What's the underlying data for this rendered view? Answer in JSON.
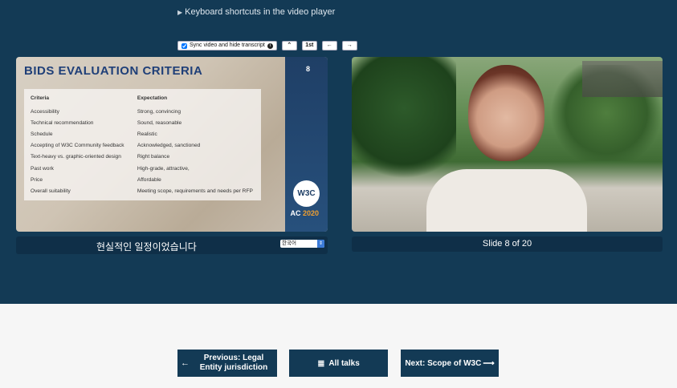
{
  "shortcuts": {
    "label": "Keyboard shortcuts in the video player"
  },
  "controls": {
    "sync_label": "Sync video and hide transcript",
    "up": "⌃",
    "first": "1st",
    "prev": "←",
    "next": "→"
  },
  "slide": {
    "title": "BIDS EVALUATION CRITERIA",
    "page": "8",
    "headers": [
      "Criteria",
      "Expectation"
    ],
    "rows": [
      [
        "Accessibility",
        "Strong, convincing"
      ],
      [
        "Technical recommendation",
        "Sound, reasonable"
      ],
      [
        "Schedule",
        "Realistic"
      ],
      [
        "Accepting of W3C Community feedback",
        "Acknowledged, sanctioned"
      ],
      [
        "Text-heavy vs. graphic-oriented design",
        "Right balance"
      ],
      [
        "Past work",
        "High-grade, attractive,"
      ],
      [
        "Price",
        "Affordable"
      ],
      [
        "Overall suitability",
        "Meeting scope, requirements and needs per RFP"
      ]
    ],
    "logo": "W3C",
    "ac_prefix": "AC ",
    "ac_year": "2020"
  },
  "caption": {
    "text": "현실적인 일정이었습니다",
    "language": "한국어"
  },
  "video_caption": "Slide 8 of 20",
  "nav": {
    "prev_label": "Previous: Legal Entity jurisdiction",
    "all_label": "All talks",
    "next_label": "Next: Scope of W3C"
  }
}
